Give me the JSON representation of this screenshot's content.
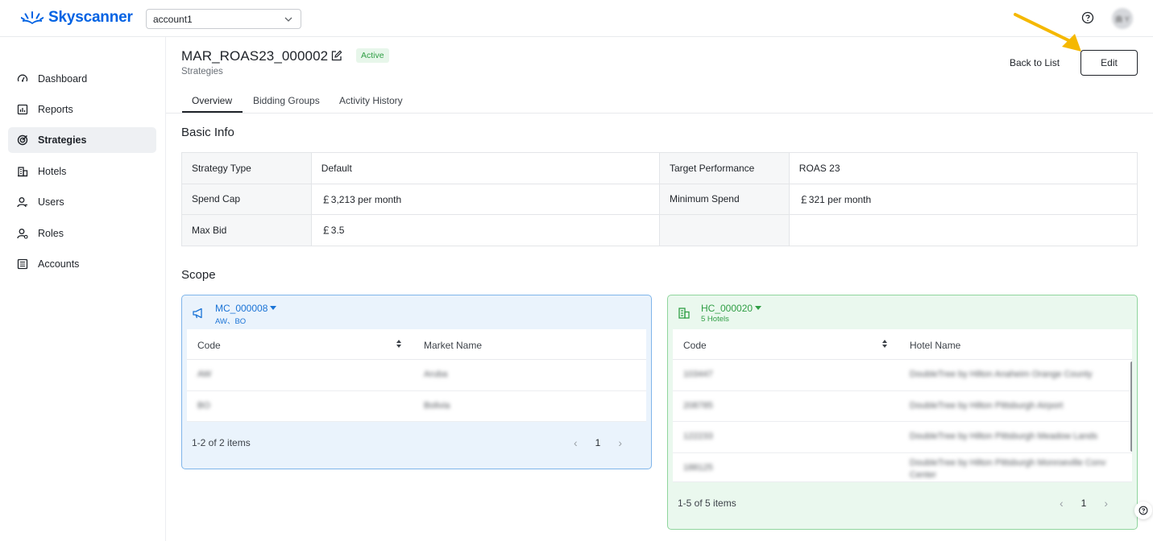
{
  "header": {
    "brand": "Skyscanner",
    "account_select": {
      "value": "account1"
    },
    "avatar_initials": "曲 Y"
  },
  "sidebar": {
    "items": [
      {
        "label": "Dashboard",
        "icon": "dashboard-icon",
        "active": false
      },
      {
        "label": "Reports",
        "icon": "reports-icon",
        "active": false
      },
      {
        "label": "Strategies",
        "icon": "target-icon",
        "active": true
      },
      {
        "label": "Hotels",
        "icon": "building-icon",
        "active": false
      },
      {
        "label": "Users",
        "icon": "user-icon",
        "active": false
      },
      {
        "label": "Roles",
        "icon": "role-icon",
        "active": false
      },
      {
        "label": "Accounts",
        "icon": "accounts-icon",
        "active": false
      }
    ]
  },
  "page": {
    "title": "MAR_ROAS23_000002",
    "status": "Active",
    "breadcrumb": "Strategies",
    "back_label": "Back to List",
    "edit_label": "Edit",
    "tabs": [
      {
        "label": "Overview",
        "active": true
      },
      {
        "label": "Bidding Groups",
        "active": false
      },
      {
        "label": "Activity History",
        "active": false
      }
    ]
  },
  "basic_info": {
    "title": "Basic Info",
    "rows": [
      {
        "l1": "Strategy Type",
        "v1": "Default",
        "l2": "Target Performance",
        "v2": "ROAS 23"
      },
      {
        "l1": "Spend Cap",
        "v1": "￡3,213 per month",
        "l2": "Minimum Spend",
        "v2": "￡321 per month"
      },
      {
        "l1": "Max Bid",
        "v1": "￡3.5",
        "l2": "",
        "v2": ""
      }
    ]
  },
  "scope": {
    "title": "Scope",
    "market": {
      "code": "MC_000008",
      "sub": "AW、BO",
      "col_code": "Code",
      "col_name": "Market Name",
      "rows": [
        {
          "code": "AW",
          "name": "Aruba"
        },
        {
          "code": "BO",
          "name": "Bolivia"
        }
      ],
      "pager_text": "1-2 of 2 items",
      "page": "1"
    },
    "hotel": {
      "code": "HC_000020",
      "sub": "5 Hotels",
      "col_code": "Code",
      "col_name": "Hotel Name",
      "rows": [
        {
          "code": "103447",
          "name": "DoubleTree by Hilton Anaheim Orange County"
        },
        {
          "code": "208785",
          "name": "DoubleTree by Hilton Pittsburgh Airport"
        },
        {
          "code": "122233",
          "name": "DoubleTree by Hilton Pittsburgh Meadow Lands"
        },
        {
          "code": "188125",
          "name": "DoubleTree by Hilton Pittsburgh Monroeville Conv Center"
        }
      ],
      "pager_text": "1-5 of 5 items",
      "page": "1"
    }
  },
  "colors": {
    "brand": "#0062e3",
    "active_badge": "#2f9e44",
    "market_accent": "#1a73d6",
    "hotel_accent": "#2f9e44",
    "annotation_arrow": "#f5b800"
  }
}
